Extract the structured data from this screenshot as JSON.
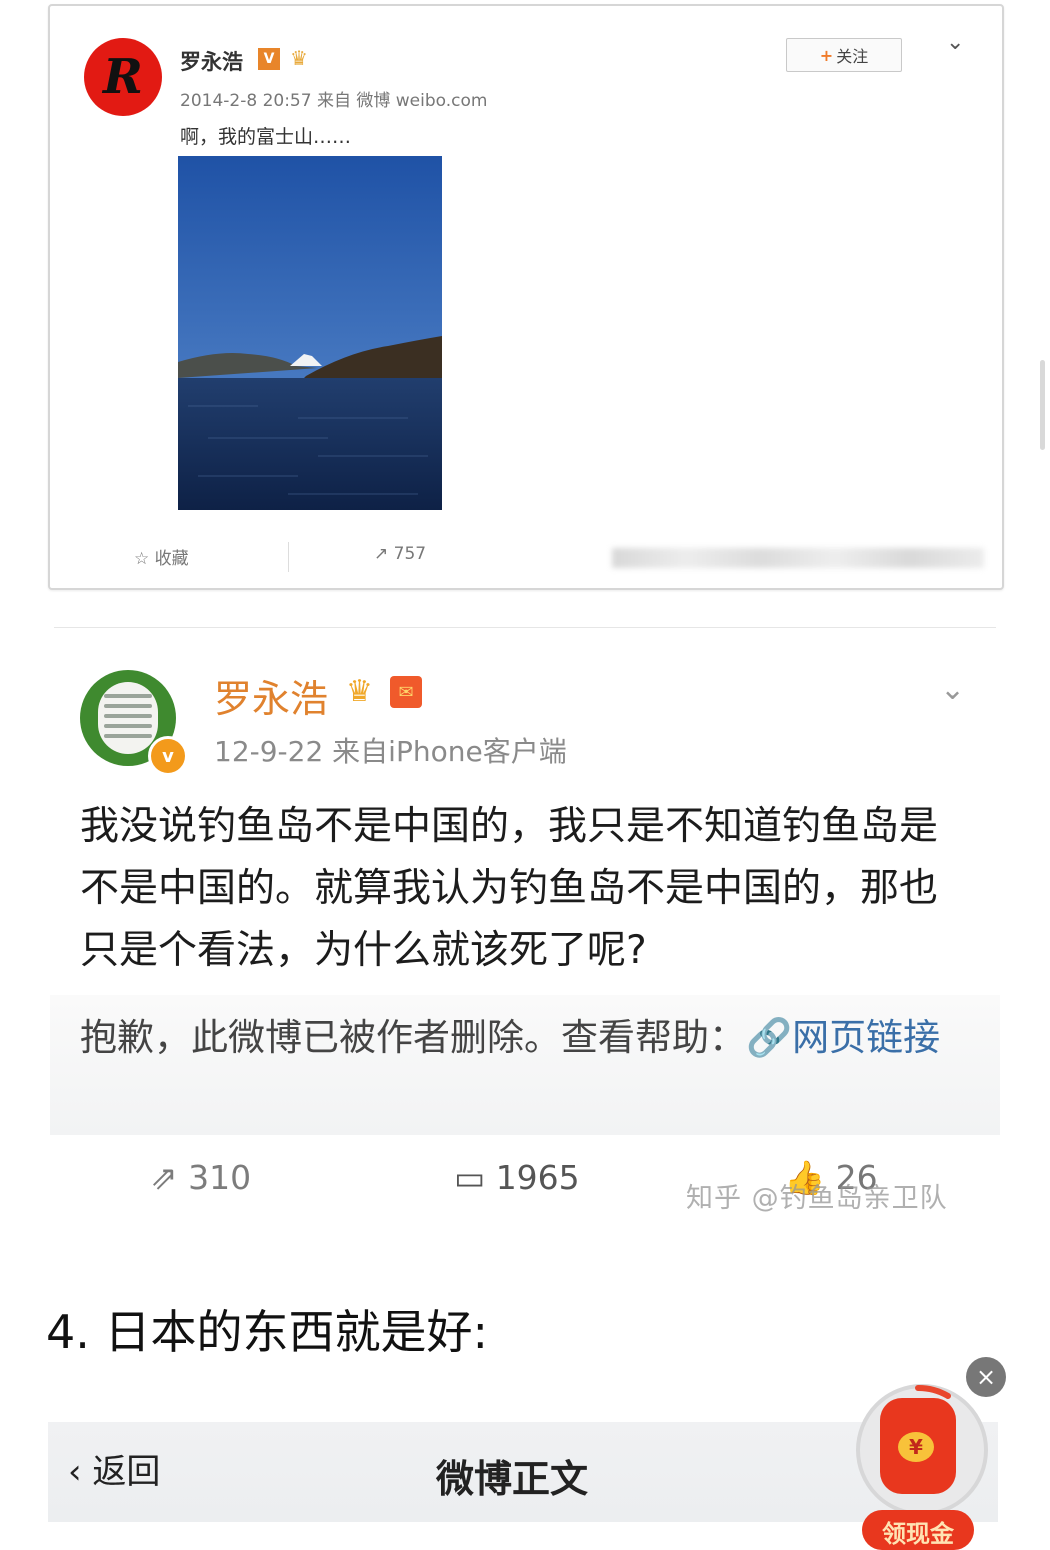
{
  "post1": {
    "author": "罗永浩",
    "v_badge": "V",
    "meta": "2014-2-8 20:57 来自 微博 weibo.com",
    "follow_label": "关注",
    "text": "啊，我的富士山……",
    "fav_label": "收藏",
    "repost_count": "757"
  },
  "post2": {
    "author": "罗永浩",
    "meta": "12-9-22  来自iPhone客户端",
    "text": "我没说钓鱼岛不是中国的，我只是不知道钓鱼岛是不是中国的。就算我认为钓鱼岛不是中国的，那也只是个看法，为什么就该死了呢?",
    "deleted_notice": "抱歉，此微博已被作者删除。查看帮助：",
    "link_label": "网页链接",
    "repost_count": "310",
    "comment_count": "1965",
    "like_count": "26"
  },
  "watermark": "知乎 @钓鱼岛亲卫队",
  "section_heading": "4. 日本的东西就是好:",
  "bottom_nav": {
    "back_label": "返回",
    "title": "微博正文"
  },
  "red_packet": {
    "label": "领现金",
    "coin": "¥"
  },
  "colors": {
    "name_orange": "#e0822e",
    "link_blue": "#3a6fa8",
    "avatar_red": "#e21a13",
    "avatar_green": "#3f8a2f"
  }
}
